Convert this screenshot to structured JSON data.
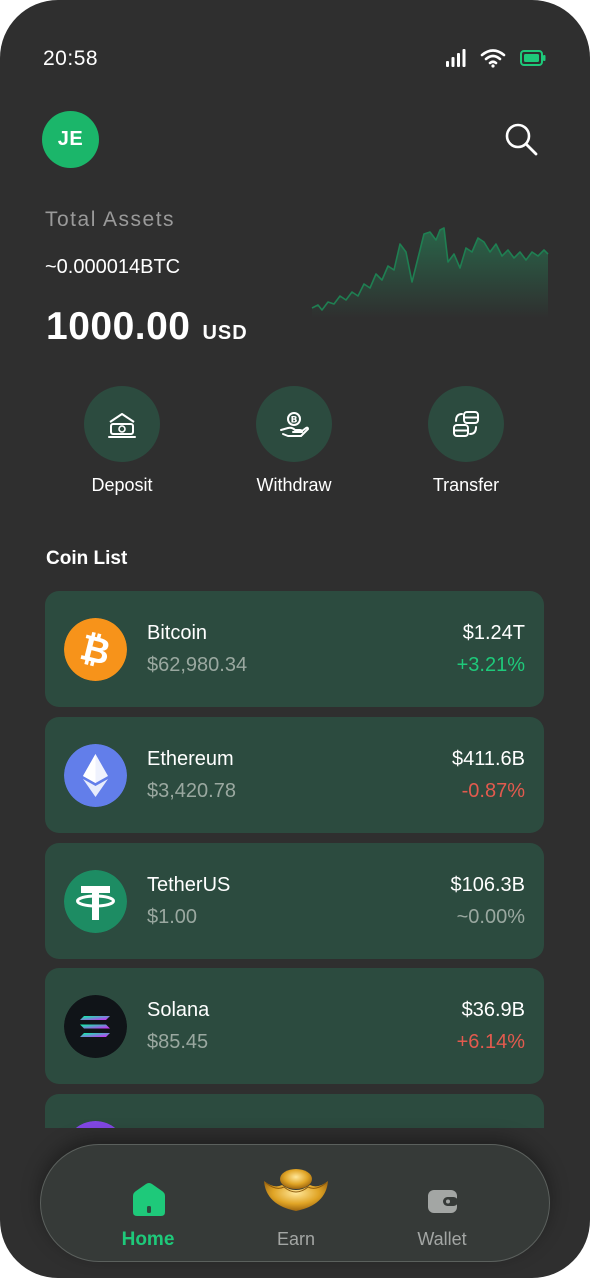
{
  "status_bar": {
    "time": "20:58"
  },
  "header": {
    "avatar_initials": "JE"
  },
  "assets": {
    "label": "Total Assets",
    "btc": "~0.000014BTC",
    "usd_amount": "1000.00",
    "usd_currency": "USD"
  },
  "actions": [
    {
      "label": "Deposit",
      "icon": "deposit-icon"
    },
    {
      "label": "Withdraw",
      "icon": "withdraw-icon"
    },
    {
      "label": "Transfer",
      "icon": "transfer-icon"
    }
  ],
  "coin_list": {
    "title": "Coin List",
    "coins": [
      {
        "name": "Bitcoin",
        "price": "$62,980.34",
        "market_cap": "$1.24T",
        "change": "+3.21%",
        "trend": "up",
        "icon": "bitcoin-logo"
      },
      {
        "name": "Ethereum",
        "price": "$3,420.78",
        "market_cap": "$411.6B",
        "change": "-0.87%",
        "trend": "down",
        "icon": "ethereum-logo"
      },
      {
        "name": "TetherUS",
        "price": "$1.00",
        "market_cap": "$106.3B",
        "change": "~0.00%",
        "trend": "flat",
        "icon": "tether-logo"
      },
      {
        "name": "Solana",
        "price": "$85.45",
        "market_cap": "$36.9B",
        "change": "+6.14%",
        "trend": "down",
        "icon": "solana-logo"
      }
    ]
  },
  "nav": {
    "items": [
      {
        "label": "Home",
        "icon": "home-icon",
        "active": true
      },
      {
        "label": "Earn",
        "icon": "gold-ingot-icon",
        "active": false
      },
      {
        "label": "Wallet",
        "icon": "wallet-icon",
        "active": false
      }
    ]
  },
  "colors": {
    "background": "#2f2f2f",
    "card": "#2c4b3f",
    "accent": "#1ec97a",
    "negative": "#e25a4e"
  }
}
